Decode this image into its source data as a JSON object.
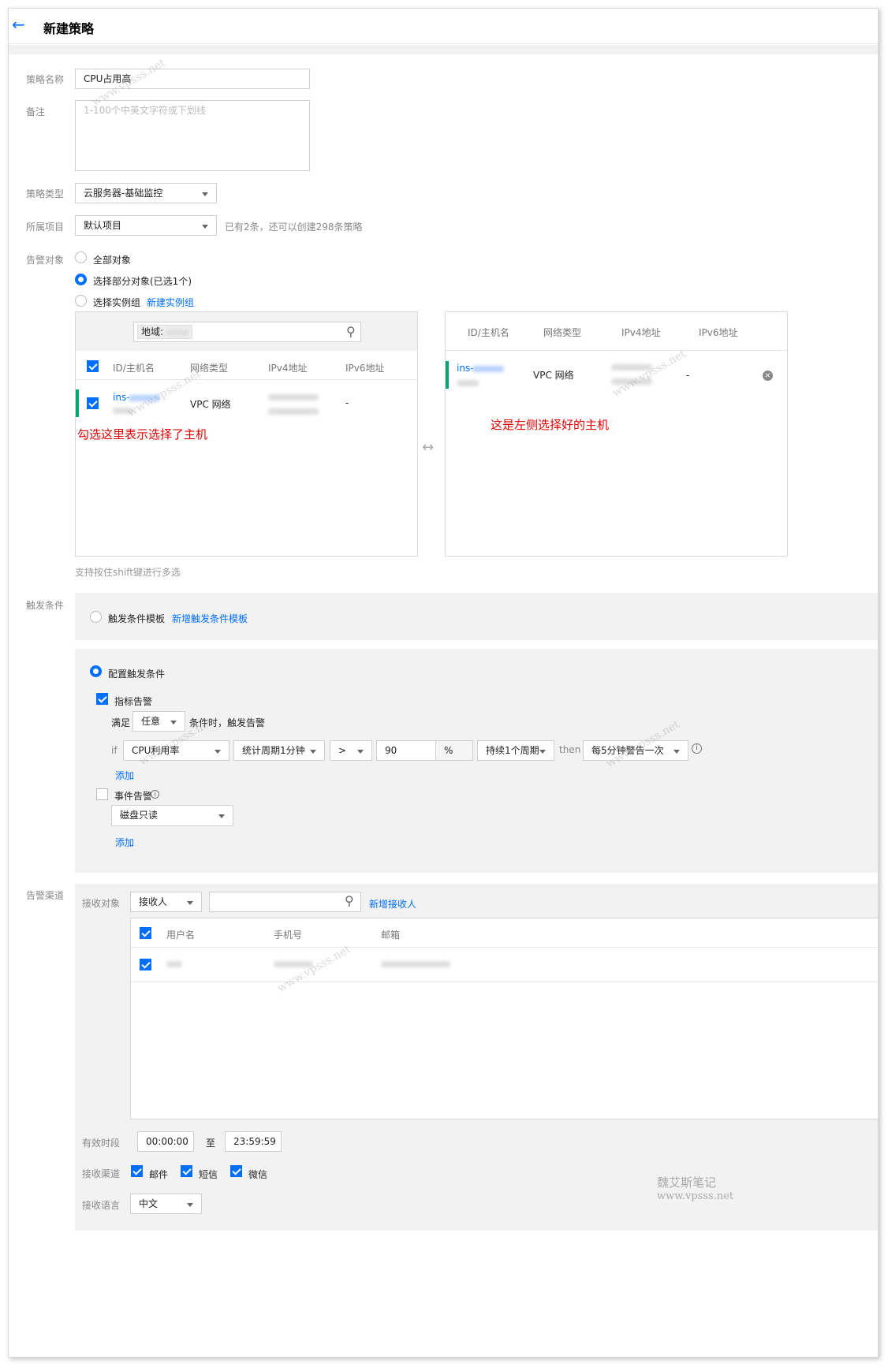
{
  "header": {
    "title": "新建策略"
  },
  "form": {
    "name_label": "策略名称",
    "name_value": "CPU占用高",
    "remark_label": "备注",
    "remark_placeholder": "1-100个中英文字符或下划线",
    "type_label": "策略类型",
    "type_value": "云服务器-基础监控",
    "project_label": "所属项目",
    "project_value": "默认项目",
    "project_hint": "已有2条，还可以创建298条策略",
    "target_label": "告警对象",
    "target_options": [
      "全部对象",
      "选择部分对象(已选1个)",
      "选择实例组"
    ],
    "new_group_link": "新建实例组"
  },
  "left_panel": {
    "region_label": "地域:",
    "columns": [
      "ID/主机名",
      "网络类型",
      "IPv4地址",
      "IPv6地址"
    ],
    "row": {
      "id": "ins-",
      "network": "VPC 网络",
      "ipv6": "-"
    },
    "annotation": "勾选这里表示选择了主机",
    "hint": "支持按住shift键进行多选"
  },
  "right_panel": {
    "columns": [
      "ID/主机名",
      "网络类型",
      "IPv4地址",
      "IPv6地址"
    ],
    "row": {
      "id": "ins-",
      "network": "VPC 网络",
      "ipv6": "-"
    },
    "annotation": "这是左侧选择好的主机"
  },
  "trigger": {
    "label": "触发条件",
    "template_option": "触发条件模板",
    "new_template_link": "新增触发条件模板",
    "config_option": "配置触发条件",
    "metric_alarm": "指标告警",
    "satisfy_prefix": "满足",
    "satisfy_value": "任意",
    "satisfy_suffix": "条件时，触发告警",
    "if_label": "if",
    "metric": "CPU利用率",
    "period": "统计周期1分钟",
    "operator": ">",
    "threshold": "90",
    "unit": "%",
    "duration": "持续1个周期",
    "then_label": "then",
    "frequency": "每5分钟警告一次",
    "add_link": "添加",
    "event_alarm": "事件告警",
    "event_value": "磁盘只读",
    "add_link2": "添加"
  },
  "channel": {
    "label": "告警渠道",
    "receiver_label": "接收对象",
    "receiver_type": "接收人",
    "new_receiver_link": "新增接收人",
    "columns": [
      "用户名",
      "手机号",
      "邮箱"
    ],
    "period_label": "有效时段",
    "start": "00:00:00",
    "to": "至",
    "end": "23:59:59",
    "channels_label": "接收渠道",
    "channels": [
      "邮件",
      "短信",
      "微信"
    ],
    "language_label": "接收语言",
    "language": "中文"
  },
  "watermark": {
    "name": "魏艾斯笔记",
    "url": "www.vpsss.net"
  },
  "colors": {
    "accent": "#006eff",
    "green": "#00a870",
    "red": "#e00000"
  }
}
